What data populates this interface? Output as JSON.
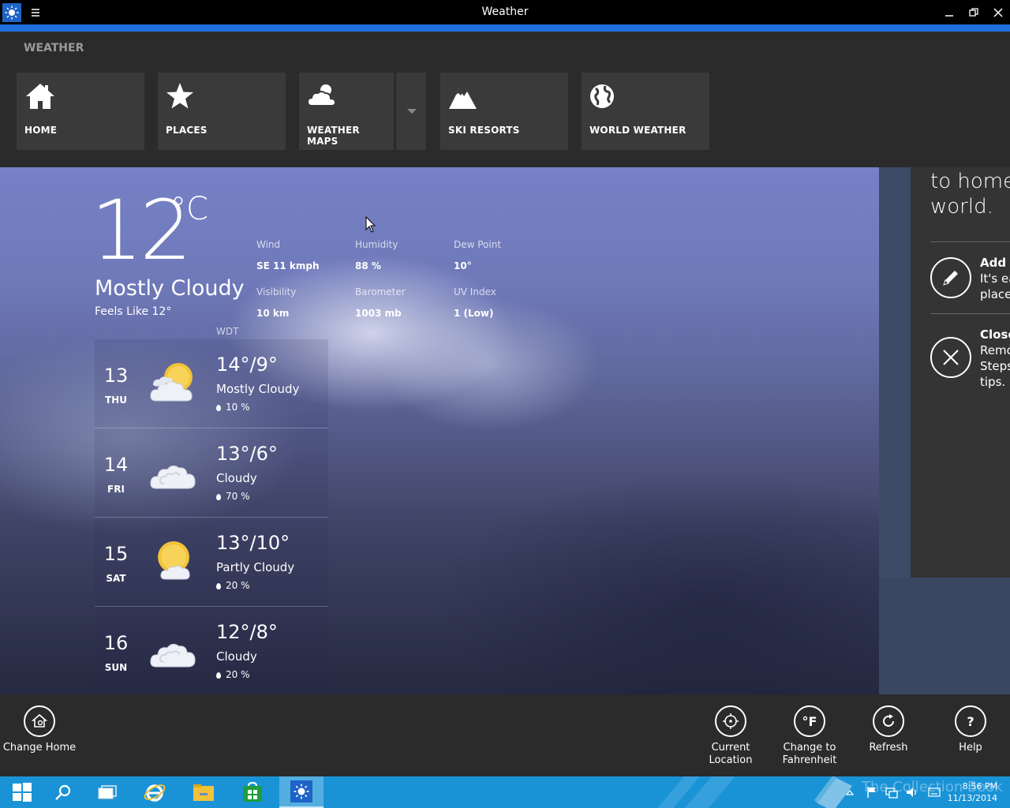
{
  "window": {
    "title": "Weather"
  },
  "nav": {
    "brand": "WEATHER",
    "tiles": [
      {
        "label": "HOME",
        "icon": "home-icon"
      },
      {
        "label": "PLACES",
        "icon": "star-icon"
      },
      {
        "label": "WEATHER MAPS",
        "icon": "weather-maps-icon"
      },
      {
        "label": "SKI RESORTS",
        "icon": "mountain-icon"
      },
      {
        "label": "WORLD WEATHER",
        "icon": "globe-icon"
      }
    ]
  },
  "current": {
    "temperature": "12",
    "unit": "°C",
    "condition": "Mostly Cloudy",
    "feels_like": "Feels Like 12°",
    "station": "WDT",
    "stats": {
      "wind_label": "Wind",
      "wind_value": "SE 11 kmph",
      "humidity_label": "Humidity",
      "humidity_value": "88 %",
      "dew_label": "Dew Point",
      "dew_value": "10°",
      "visibility_label": "Visibility",
      "visibility_value": "10 km",
      "barometer_label": "Barometer",
      "barometer_value": "1003 mb",
      "uv_label": "UV Index",
      "uv_value": "1 (Low)"
    }
  },
  "forecast": [
    {
      "day": "13",
      "dow": "THU",
      "hilo": "14°/9°",
      "desc": "Mostly Cloudy",
      "precip": "10 %",
      "icon": "mostly-cloudy-icon"
    },
    {
      "day": "14",
      "dow": "FRI",
      "hilo": "13°/6°",
      "desc": "Cloudy",
      "precip": "70 %",
      "icon": "cloudy-icon"
    },
    {
      "day": "15",
      "dow": "SAT",
      "hilo": "13°/10°",
      "desc": "Partly Cloudy",
      "precip": "20 %",
      "icon": "partly-cloudy-icon"
    },
    {
      "day": "16",
      "dow": "SUN",
      "hilo": "12°/8°",
      "desc": "Cloudy",
      "precip": "20 %",
      "icon": "cloudy-icon"
    }
  ],
  "side": {
    "line1": "to home",
    "line2": "world.",
    "item1_title": "Add y",
    "item1_l1": "It's ea",
    "item1_l2": "places",
    "item2_title": "Close",
    "item2_l1": "Remo",
    "item2_l2": "Steps",
    "item2_l3": "tips."
  },
  "appbar": {
    "change_home": "Change Home",
    "current_location_1": "Current",
    "current_location_2": "Location",
    "fahrenheit_1": "Change to",
    "fahrenheit_2": "Fahrenheit",
    "fahrenheit_glyph": "°F",
    "refresh": "Refresh",
    "help": "Help",
    "help_glyph": "?"
  },
  "taskbar": {
    "time": "8:56 PM",
    "date": "11/13/2014",
    "watermark": "The Collection Book"
  }
}
